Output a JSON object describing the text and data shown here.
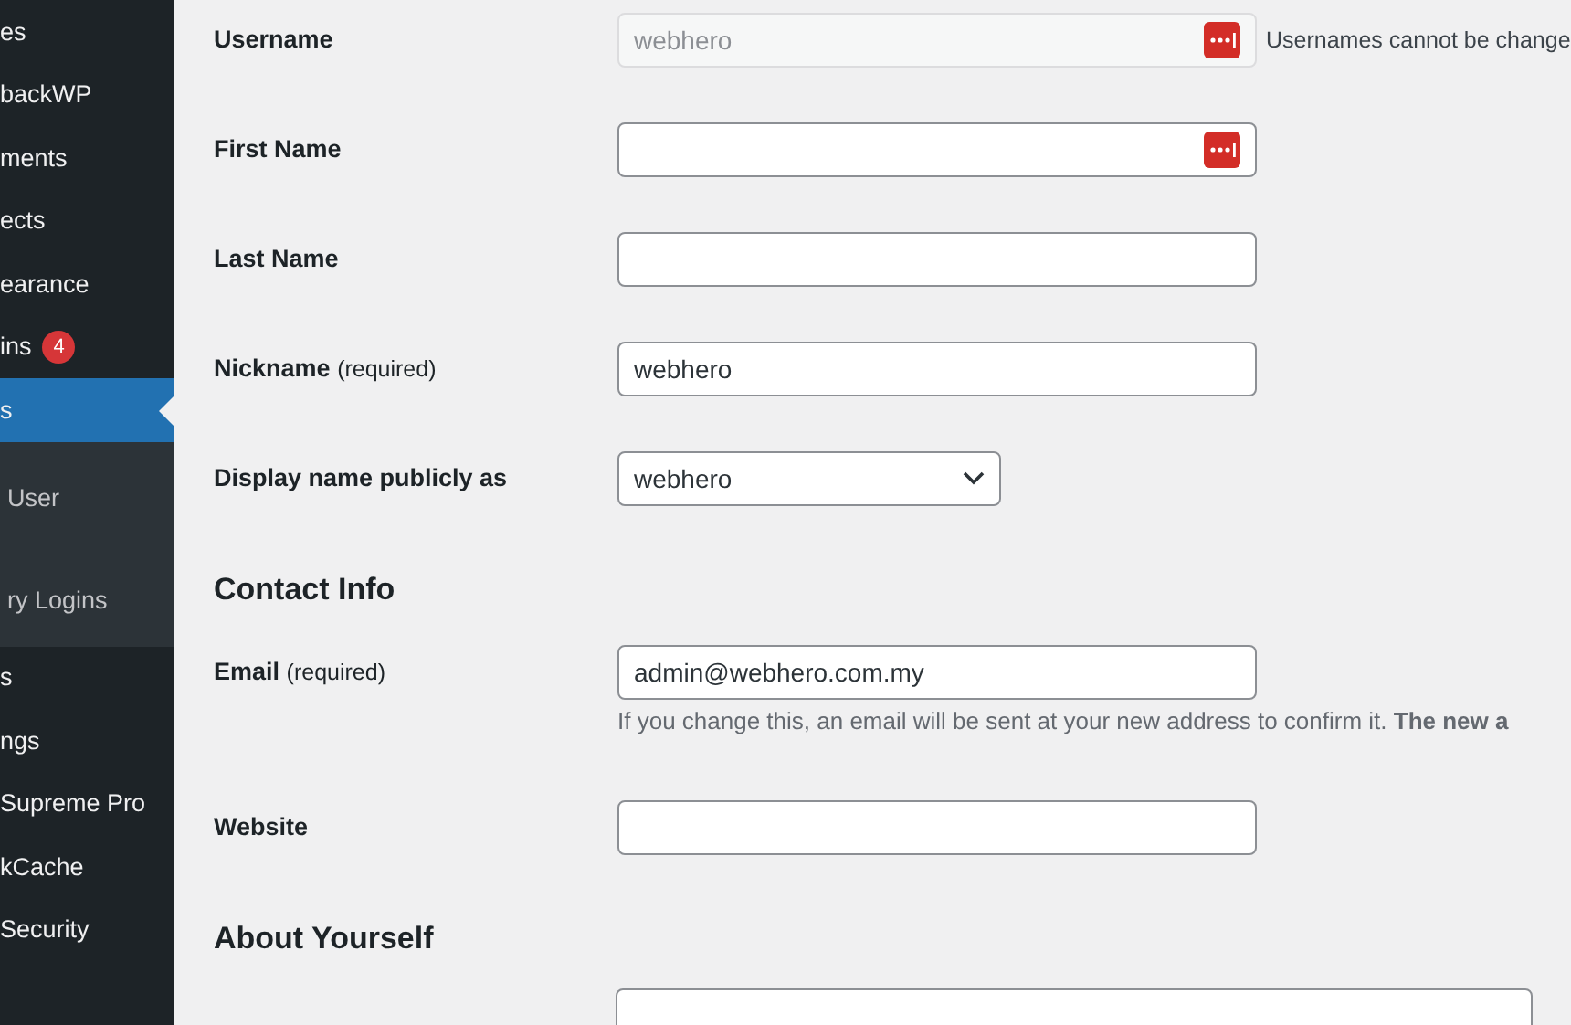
{
  "sidebar": {
    "items": [
      {
        "label": "es",
        "selected": false
      },
      {
        "label": "backWP",
        "selected": false
      },
      {
        "label": "ments",
        "selected": false
      },
      {
        "label": "ects",
        "selected": false
      },
      {
        "label": "earance",
        "selected": false
      },
      {
        "label": "ins",
        "badge": "4",
        "selected": false
      },
      {
        "label": "s",
        "selected": true,
        "children": [
          {
            "label": "User",
            "selected": false
          },
          {
            "label": "ry Logins",
            "selected": false
          }
        ]
      },
      {
        "label": "s",
        "selected": false
      },
      {
        "label": "ngs",
        "selected": false
      },
      {
        "label": "Supreme Pro",
        "selected": false
      },
      {
        "label": "kCache",
        "selected": false
      },
      {
        "label": "Security",
        "selected": false
      }
    ]
  },
  "form": [
    {
      "kind": "field",
      "label": "Username",
      "value": "webhero",
      "disabled": true,
      "password_icon": true,
      "hint": "Usernames cannot be change"
    },
    {
      "kind": "field",
      "label": "First Name",
      "disabled": false,
      "password_icon": true
    },
    {
      "kind": "field",
      "label": "Last Name",
      "disabled": false,
      "password_icon": false
    },
    {
      "kind": "field",
      "label": "Nickname",
      "note": "(required)",
      "value": "webhero",
      "disabled": false,
      "password_icon": false
    },
    {
      "kind": "select",
      "label": "Display name publicly as",
      "value": "webhero"
    },
    {
      "kind": "heading",
      "label": "Contact Info"
    },
    {
      "kind": "field",
      "label": "Email",
      "note": "(required)",
      "value": "admin@webhero.com.my",
      "disabled": false,
      "password_icon": false,
      "description": "If you change this, an email will be sent at your new address to confirm it. **The new a**"
    },
    {
      "kind": "field",
      "label": "Website",
      "disabled": false,
      "password_icon": false
    },
    {
      "kind": "heading",
      "label": "About Yourself"
    },
    {
      "kind": "textarea"
    }
  ]
}
